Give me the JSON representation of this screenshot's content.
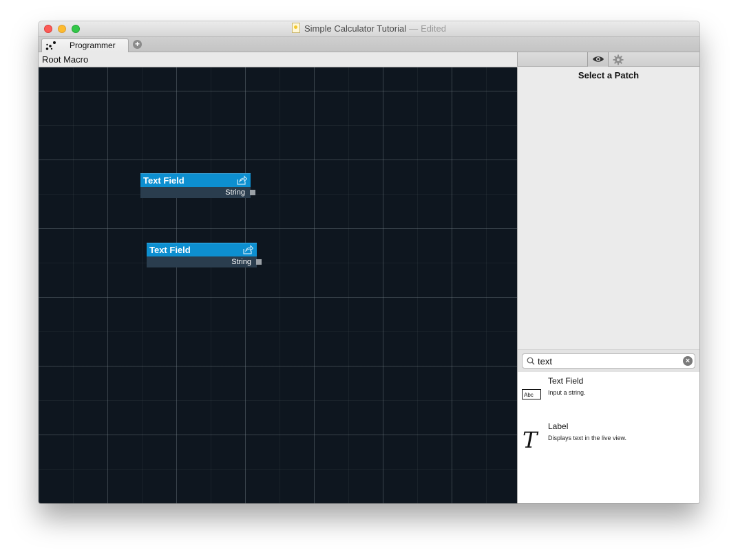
{
  "window": {
    "title": "Simple Calculator Tutorial",
    "title_separator": "—",
    "title_status": "Edited"
  },
  "tabs": [
    {
      "label": "Programmer",
      "icon": "nodes-icon",
      "selected": true
    }
  ],
  "add_tab_icon": "plus-circle-icon",
  "breadcrumb": "Root Macro",
  "sidebar_toolbar": {
    "icons": [
      "eye-icon",
      "gear-icon"
    ]
  },
  "inspector": {
    "title": "Select a Patch"
  },
  "patches": [
    {
      "title": "Text Field",
      "output": "String"
    },
    {
      "title": "Text Field",
      "output": "String"
    }
  ],
  "search": {
    "value": "text",
    "placeholder": ""
  },
  "results": [
    {
      "name": "Text Field",
      "description": "Input a string.",
      "icon_text": "Abc"
    },
    {
      "name": "Label",
      "description": "Displays text in the live view.",
      "icon_text": "T"
    }
  ],
  "colors": {
    "canvas": "#0e161f",
    "patch_header": "#0d8fd0",
    "patch_body": "#2a3d4e"
  }
}
